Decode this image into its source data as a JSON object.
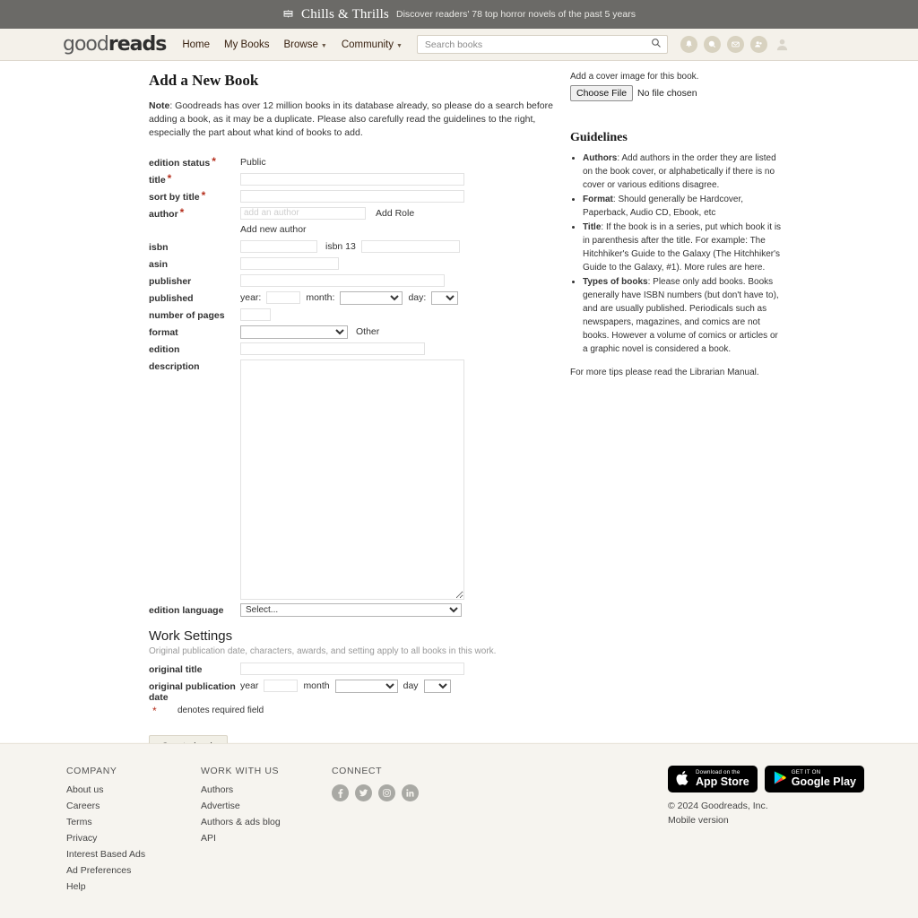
{
  "promo": {
    "icon": "books-stack-icon",
    "title": "Chills & Thrills",
    "subtitle": "Discover readers' 78 top horror novels of the past 5 years"
  },
  "header": {
    "logo_good": "good",
    "logo_reads": "reads",
    "nav": [
      {
        "label": "Home",
        "caret": false
      },
      {
        "label": "My Books",
        "caret": false
      },
      {
        "label": "Browse",
        "caret": true
      },
      {
        "label": "Community",
        "caret": true
      }
    ],
    "search": {
      "placeholder": "Search books",
      "value": ""
    },
    "icons": [
      "bell-icon",
      "comment-icon",
      "envelope-icon",
      "friends-icon",
      "avatar-icon"
    ]
  },
  "main": {
    "title": "Add a New Book",
    "note_label": "Note",
    "note_text": ": Goodreads has over 12 million books in its database already, so please do a search before adding a book, as it may be a duplicate. Please also carefully read the guidelines to the right, especially the part about what kind of books to add.",
    "fields": {
      "edition_status": {
        "label": "edition status",
        "required": true,
        "value": "Public"
      },
      "title": {
        "label": "title",
        "required": true,
        "value": ""
      },
      "sort_by_title": {
        "label": "sort by title",
        "required": true,
        "value": ""
      },
      "author": {
        "label": "author",
        "required": true,
        "value": "",
        "placeholder": "add an author",
        "add_role": "Add Role",
        "add_new": "Add new author"
      },
      "isbn": {
        "label": "isbn",
        "value": "",
        "isbn13_label": "isbn 13",
        "isbn13_value": ""
      },
      "asin": {
        "label": "asin",
        "value": ""
      },
      "publisher": {
        "label": "publisher",
        "value": ""
      },
      "published": {
        "label": "published",
        "year_label": "year:",
        "year_value": "",
        "month_label": "month:",
        "month_value": "",
        "day_label": "day:",
        "day_value": ""
      },
      "number_of_pages": {
        "label": "number of pages",
        "value": ""
      },
      "format": {
        "label": "format",
        "value": "",
        "other_label": "Other"
      },
      "edition": {
        "label": "edition",
        "value": ""
      },
      "description": {
        "label": "description",
        "value": ""
      },
      "edition_language": {
        "label": "edition language",
        "value": "Select..."
      }
    },
    "work_settings": {
      "heading": "Work Settings",
      "subtext": "Original publication date, characters, awards, and setting apply to all books in this work.",
      "original_title": {
        "label": "original title",
        "value": ""
      },
      "original_publication_date": {
        "label": "original publication date",
        "year_label": "year",
        "year_value": "",
        "month_label": "month",
        "month_value": "",
        "day_label": "day",
        "day_value": ""
      }
    },
    "denotes_required": "denotes required field",
    "create_button": "Create book"
  },
  "sidebar": {
    "cover_note": "Add a cover image for this book.",
    "file_button": "Choose File",
    "file_status": "No file chosen",
    "guidelines_title": "Guidelines",
    "guidelines": [
      {
        "term": "Authors",
        "text": ": Add authors in the order they are listed on the book cover, or alphabetically if there is no cover or various editions disagree."
      },
      {
        "term": "Format",
        "text": ": Should generally be Hardcover, Paperback, Audio CD, Ebook, etc"
      },
      {
        "term": "Title",
        "text": ": If the book is in a series, put which book it is in parenthesis after the title. For example: The Hitchhiker's Guide to the Galaxy (The Hitchhiker's Guide to the Galaxy, #1). More rules are here."
      },
      {
        "term": "Types of books",
        "text": ": Please only add books. Books generally have ISBN numbers (but don't have to), and are usually published. Periodicals such as newspapers, magazines, and comics are not books. However a volume of comics or articles or a graphic novel is considered a book."
      }
    ],
    "footer_tip": "For more tips please read the Librarian Manual."
  },
  "footer": {
    "columns": [
      {
        "heading": "COMPANY",
        "links": [
          "About us",
          "Careers",
          "Terms",
          "Privacy",
          "Interest Based Ads",
          "Ad Preferences",
          "Help"
        ]
      },
      {
        "heading": "WORK WITH US",
        "links": [
          "Authors",
          "Advertise",
          "Authors & ads blog",
          "API"
        ]
      }
    ],
    "connect_heading": "CONNECT",
    "social": [
      "facebook-icon",
      "twitter-icon",
      "instagram-icon",
      "linkedin-icon"
    ],
    "app_store": {
      "small": "Download on the",
      "big": "App Store"
    },
    "google_play": {
      "small": "GET IT ON",
      "big": "Google Play"
    },
    "copyright": "© 2024 Goodreads, Inc.",
    "mobile_version": "Mobile version"
  },
  "colors": {
    "promo_bg": "#6b6a67",
    "header_bg": "#f4f1ea",
    "required_star": "#b5301e",
    "footer_bg": "#f6f4ef",
    "icon_circle": "#d8d2c0"
  }
}
